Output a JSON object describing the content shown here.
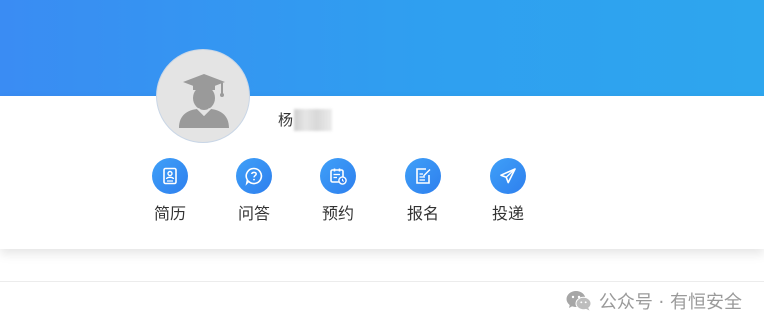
{
  "profile": {
    "avatar_icon": "graduate-avatar-icon",
    "name_visible": "杨"
  },
  "actions": [
    {
      "label": "简历",
      "icon": "resume-icon"
    },
    {
      "label": "问答",
      "icon": "question-icon"
    },
    {
      "label": "预约",
      "icon": "calendar-clock-icon"
    },
    {
      "label": "报名",
      "icon": "edit-form-icon"
    },
    {
      "label": "投递",
      "icon": "send-icon"
    }
  ],
  "watermark": {
    "icon": "wechat-icon",
    "text": "公众号 · 有恒安全"
  },
  "colors": {
    "header_start": "#3a8cf3",
    "header_end": "#2ea6ee",
    "icon_blue": "#2e7fee",
    "label_text": "#333333",
    "watermark_text": "#9a9a9a"
  }
}
